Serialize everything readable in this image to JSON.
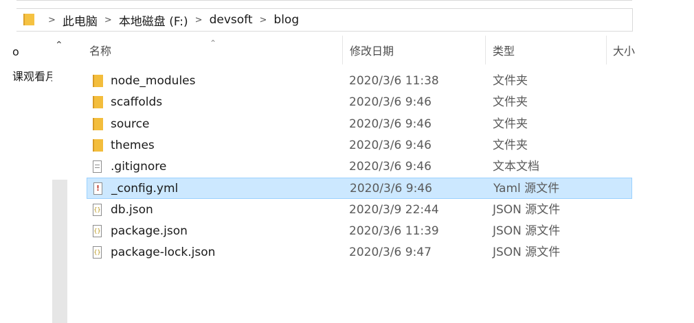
{
  "address": {
    "crumbs": [
      "此电脑",
      "本地磁盘 (F:)",
      "devsoft",
      "blog"
    ]
  },
  "nav": {
    "items": [
      "o",
      "课观看月"
    ]
  },
  "columns": {
    "name": "名称",
    "date": "修改日期",
    "type": "类型",
    "size": "大小"
  },
  "files": [
    {
      "icon": "folder-icon",
      "name": "node_modules",
      "date": "2020/3/6 11:38",
      "type": "文件夹"
    },
    {
      "icon": "folder-icon",
      "name": "scaffolds",
      "date": "2020/3/6 9:46",
      "type": "文件夹"
    },
    {
      "icon": "folder-icon",
      "name": "source",
      "date": "2020/3/6 9:46",
      "type": "文件夹"
    },
    {
      "icon": "folder-icon",
      "name": "themes",
      "date": "2020/3/6 9:46",
      "type": "文件夹"
    },
    {
      "icon": "text-file-icon",
      "name": ".gitignore",
      "date": "2020/3/6 9:46",
      "type": "文本文档"
    },
    {
      "icon": "yaml-file-icon",
      "name": "_config.yml",
      "date": "2020/3/6 9:46",
      "type": "Yaml 源文件",
      "selected": true
    },
    {
      "icon": "json-file-icon",
      "name": "db.json",
      "date": "2020/3/9 22:44",
      "type": "JSON 源文件"
    },
    {
      "icon": "json-file-icon",
      "name": "package.json",
      "date": "2020/3/6 11:39",
      "type": "JSON 源文件"
    },
    {
      "icon": "json-file-icon",
      "name": "package-lock.json",
      "date": "2020/3/6 9:47",
      "type": "JSON 源文件"
    }
  ],
  "colors": {
    "selection_bg": "#cce8ff",
    "selection_border": "#99d1ff",
    "folder": "#f3bd3c"
  }
}
